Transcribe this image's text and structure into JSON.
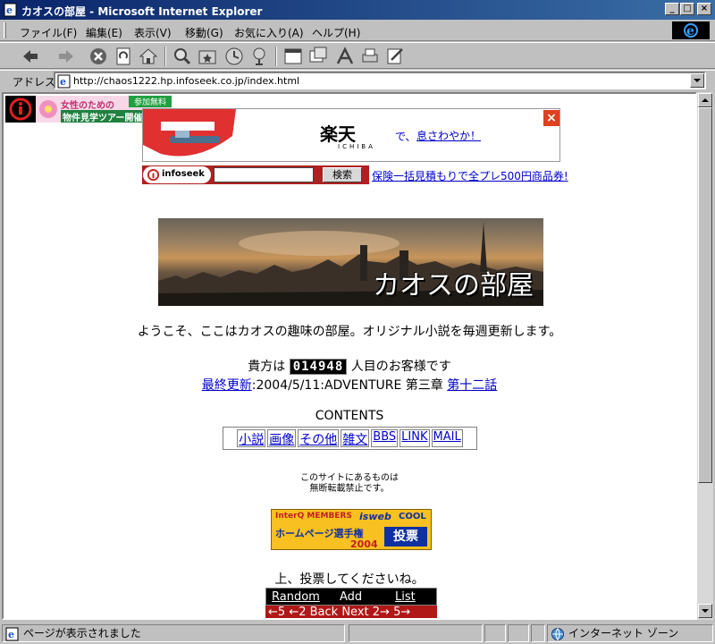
{
  "window": {
    "title": "カオスの部屋 - Microsoft Internet Explorer",
    "minimize": "_",
    "maximize": "□",
    "close": "×"
  },
  "menu": {
    "items": [
      "ファイル(F)",
      "編集(E)",
      "表示(V)",
      "移動(G)",
      "お気に入り(A)",
      "ヘルプ(H)"
    ]
  },
  "address": {
    "label": "アドレス",
    "url": "http://chaos1222.hp.infoseek.co.jp/index.html"
  },
  "ads": {
    "banner_left_line1": "女性のための",
    "banner_left_badge": "参加無料",
    "banner_left_line2": "物件見学ツアー開催中",
    "rakuten_logo": "楽天",
    "rakuten_sub": "ICHIBA",
    "rakuten_de": "で、",
    "rakuten_link": "息さわやか！",
    "infoseek_logo": "infoseek",
    "search_button": "検索",
    "insurance_link": "保険一括見積もりで全プレ500円商品券!"
  },
  "hero": {
    "title": "カオスの部屋"
  },
  "welcome": "ようこそ、ここはカオスの趣味の部屋。オリジナル小説を毎週更新します。",
  "counter": {
    "prefix": "貴方は",
    "value": "014948",
    "suffix": "人目のお客様です"
  },
  "update": {
    "link_label": "最終更新",
    "text": ":2004/5/11:ADVENTURE 第三章",
    "episode_link": "第十二話"
  },
  "contents": {
    "heading": "CONTENTS",
    "items": [
      "小説",
      "画像",
      "その他",
      "雑文",
      "BBS",
      "LINK",
      "MAIL"
    ]
  },
  "notice": {
    "line1": "このサイトにあるものは",
    "line2": "無断転載禁止です。"
  },
  "vote_banner": {
    "brand1": "InterQ MEMBERS",
    "brand2": "isweb",
    "brand3": "COOL",
    "title": "ホームページ選手権",
    "year": "2004",
    "vote": "投票"
  },
  "vote_message": "上、投票してくださいね。",
  "ring": {
    "random": "Random",
    "add": "Add",
    "list": "List",
    "prev5": "←5",
    "prev2": "←2",
    "back": "Back",
    "next": "Next",
    "next2": "2→",
    "next5": "5→"
  },
  "status": {
    "message": "ページが表示されました",
    "zone": "インターネット ゾーン"
  }
}
